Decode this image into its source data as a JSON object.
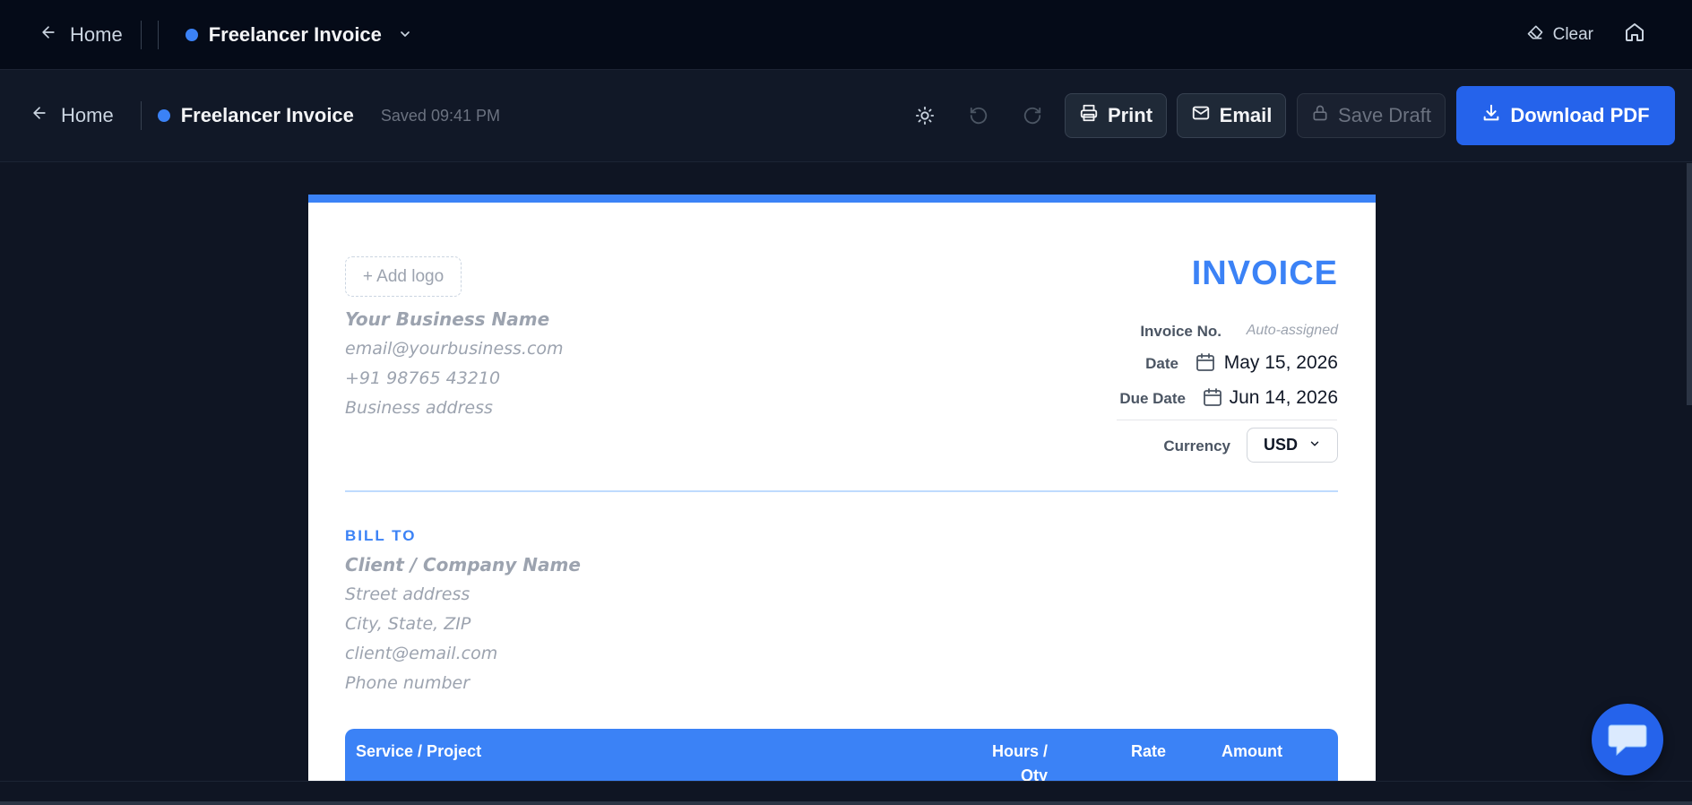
{
  "topbar": {
    "home_label": "Home",
    "doc_title": "Freelancer Invoice",
    "clear_label": "Clear"
  },
  "toolbar": {
    "home_label": "Home",
    "doc_title": "Freelancer Invoice",
    "saved_status": "Saved 09:41 PM",
    "print_label": "Print",
    "email_label": "Email",
    "save_draft_label": "Save Draft",
    "download_label": "Download PDF"
  },
  "invoice": {
    "add_logo": "+ Add logo",
    "business_name": "Your Business Name",
    "business_email": "email@yourbusiness.com",
    "business_phone": "+91 98765 43210",
    "business_address": "Business address",
    "title": "INVOICE",
    "invoice_no_label": "Invoice No.",
    "invoice_no_value": "Auto-assigned",
    "date_label": "Date",
    "date_value": "May 15, 2026",
    "due_date_label": "Due Date",
    "due_date_value": "Jun 14, 2026",
    "currency_label": "Currency",
    "currency_value": "USD",
    "bill_to_label": "BILL TO",
    "client_name": "Client / Company Name",
    "client_street": "Street address",
    "client_city": "City, State, ZIP",
    "client_email": "client@email.com",
    "client_phone": "Phone number",
    "table_headers": {
      "service": "Service / Project",
      "hours_line1": "Hours /",
      "hours_line2": "Qty",
      "rate": "Rate",
      "amount": "Amount"
    }
  },
  "colors": {
    "accent": "#3b82f6",
    "primary_button": "#2563eb",
    "background": "#0f1523"
  }
}
